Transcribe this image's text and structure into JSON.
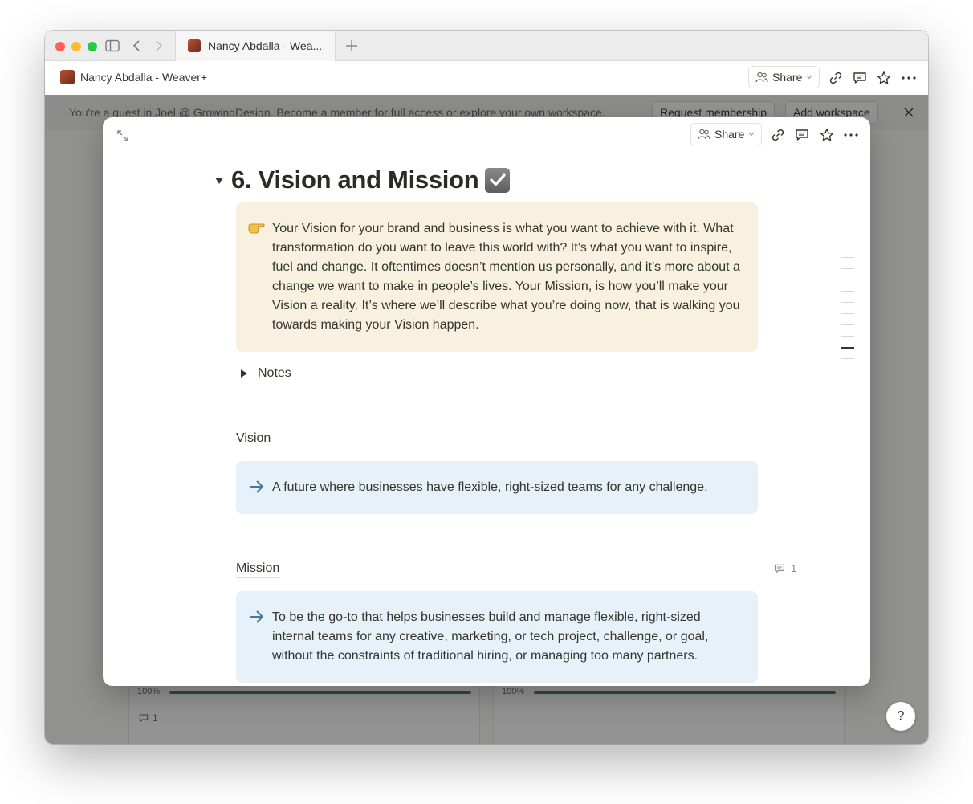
{
  "browser": {
    "tab_title": "Nancy Abdalla - Wea...",
    "new_tab_label": "+"
  },
  "page_header": {
    "title": "Nancy Abdalla - Weaver+",
    "share_label": "Share"
  },
  "banner": {
    "text": "You're a guest in Joel @ GrowingDesign. Become a member for full access or explore your own workspace.",
    "request_label": "Request membership",
    "add_workspace_label": "Add workspace"
  },
  "background_cards": [
    {
      "progress_label": "100%",
      "progress": 1.0,
      "comment_count": "1"
    },
    {
      "progress_label": "100%",
      "progress": 1.0
    }
  ],
  "help_label": "?",
  "modal": {
    "share_label": "Share",
    "heading": "6. Vision and Mission",
    "heading_emoji": "check-box-with-check",
    "intro_callout": {
      "icon": "pointing-hand-icon",
      "text": "Your Vision for your brand and business is what you want to achieve with it. What transformation do you want to leave this world with? It’s what you want to inspire, fuel and change. It oftentimes doesn’t mention us personally, and it’s more about a change we want to make in people’s lives. Your Mission, is how you’ll make your Vision a reality. It’s where we’ll describe what you’re doing now, that is walking you towards making your Vision happen."
    },
    "notes_toggle_label": "Notes",
    "vision": {
      "label": "Vision",
      "text": "A future where businesses have flexible, right-sized teams for any challenge."
    },
    "mission": {
      "label": "Mission",
      "comment_count": "1",
      "text": "To be the go-to that helps businesses build and manage flexible, right-sized internal teams for any creative, marketing, or tech project, challenge, or goal, without the constraints of traditional hiring, or managing too many partners."
    }
  },
  "colors": {
    "callout_yellow": "#f8f1df",
    "callout_blue": "#e7f1f9",
    "arrow_blue": "#447aa0",
    "progress_green": "#4a7a53"
  }
}
